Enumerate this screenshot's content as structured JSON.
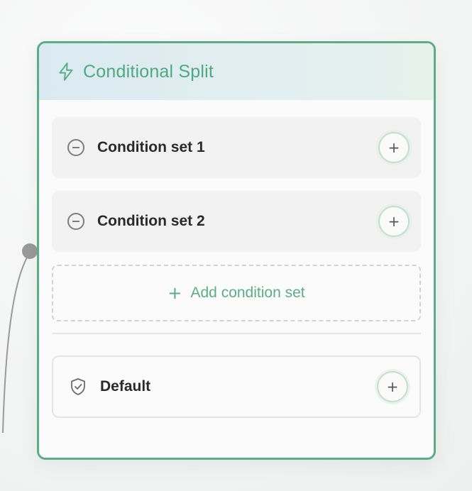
{
  "node": {
    "title": "Conditional Split",
    "icon": "lightning-bolt-icon",
    "accent_color": "#5aae86"
  },
  "condition_sets": [
    {
      "label": "Condition set 1",
      "remove_icon": "minus-circle-icon",
      "add_icon": "plus-icon",
      "add_symbol": "+"
    },
    {
      "label": "Condition set 2",
      "remove_icon": "minus-circle-icon",
      "add_icon": "plus-icon",
      "add_symbol": "+"
    }
  ],
  "add_condition_set": {
    "symbol": "+",
    "label": "Add condition set"
  },
  "default_branch": {
    "label": "Default",
    "icon": "shield-check-icon",
    "add_symbol": "+"
  }
}
